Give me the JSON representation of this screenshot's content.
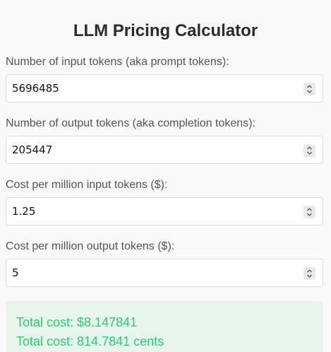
{
  "title": "LLM Pricing Calculator",
  "fields": [
    {
      "label": "Number of input tokens (aka prompt tokens):",
      "value": "5696485"
    },
    {
      "label": "Number of output tokens (aka completion tokens):",
      "value": "205447"
    },
    {
      "label": "Cost per million input tokens ($):",
      "value": "1.25"
    },
    {
      "label": "Cost per million output tokens ($):",
      "value": "5"
    }
  ],
  "result": {
    "total_dollars": "Total cost: $8.147841",
    "total_cents": "Total cost: 814.7841 cents"
  },
  "colors": {
    "result_background": "#e8f5ec",
    "result_text": "#2ecc71"
  }
}
